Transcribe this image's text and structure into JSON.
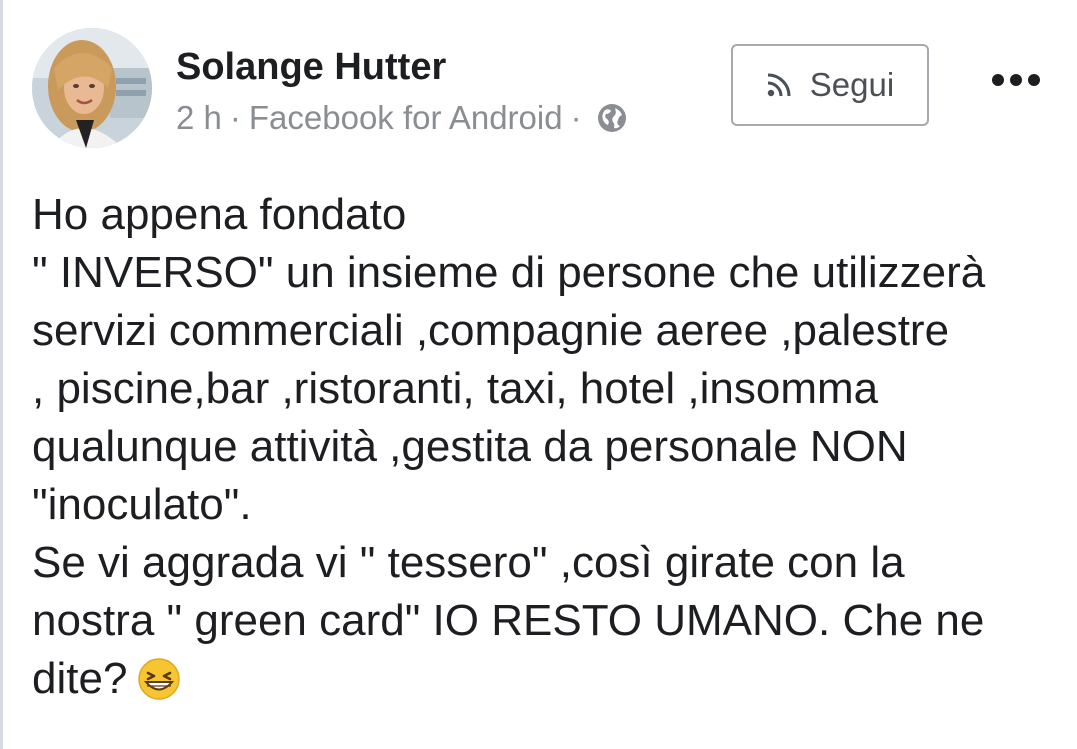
{
  "post": {
    "author_name": "Solange Hutter",
    "time": "2 h",
    "separator": "·",
    "source": "Facebook for Android",
    "privacy_icon": "globe-icon",
    "follow_label": "Segui",
    "follow_icon": "rss-icon",
    "more_icon": "more-options-icon",
    "body_lines": [
      "Ho appena fondato",
      "\" INVERSO\" un insieme di persone che utilizzerà",
      "servizi commerciali ,compagnie aeree ,palestre",
      ", piscine,bar ,ristoranti, taxi, hotel ,insomma",
      "qualunque attività ,gestita da personale NON",
      "\"inoculato\".",
      "Se vi aggrada vi \" tessero\" ,così girate con la",
      "nostra \" green card\" IO RESTO UMANO. Che ne",
      "dite?"
    ],
    "trailing_emoji": "grinning-squinting-face-emoji"
  },
  "colors": {
    "text": "#1c1e21",
    "meta_text": "#8a8d91",
    "button_border": "#a6a9ad",
    "emoji_yellow": "#f7c531"
  }
}
